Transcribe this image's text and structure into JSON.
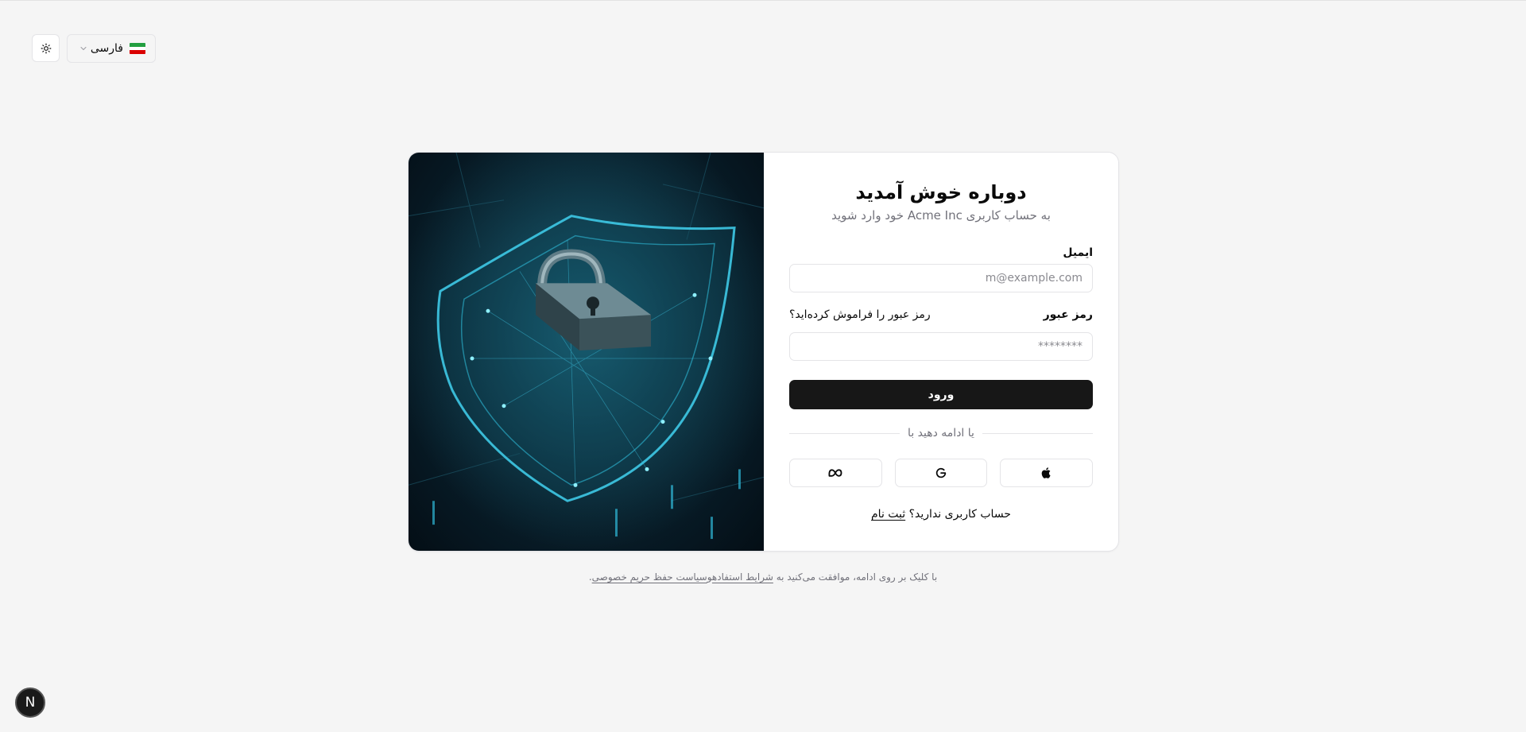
{
  "topbar": {
    "theme_icon": "sun-icon",
    "language": {
      "label": "فارسی",
      "flag_colors": [
        "#239f40",
        "#ffffff",
        "#da0000"
      ]
    }
  },
  "hero": {
    "icon": "shield-lock-icon",
    "accent": "#2fb7d6"
  },
  "login": {
    "title": "دوباره خوش آمدید",
    "subtitle": "به حساب کاربری Acme Inc خود وارد شوید",
    "email_label": "ایمیل",
    "email_placeholder": "m@example.com",
    "password_label": "رمز عبور",
    "forgot_password": "رمز عبور را فراموش کرده‌اید؟",
    "password_placeholder": "********",
    "submit_label": "ورود",
    "divider_text": "یا ادامه دهید با",
    "social": [
      "apple-icon",
      "google-icon",
      "meta-icon"
    ],
    "no_account": "حساب کاربری ندارید؟",
    "signup_link": "ثبت نام"
  },
  "terms": {
    "prefix": "با کلیک بر روی ادامه، موافقت می‌کنید به",
    "terms_link": "شرایط استفاده",
    "connector": "و",
    "privacy_link": "سیاست حفظ حریم خصوصی",
    "suffix": "."
  },
  "dev_badge": {
    "letter": "N"
  },
  "colors": {
    "primary": "#171717",
    "border": "#e4e4e7",
    "background": "#f5f5f5",
    "muted": "#71717a"
  }
}
